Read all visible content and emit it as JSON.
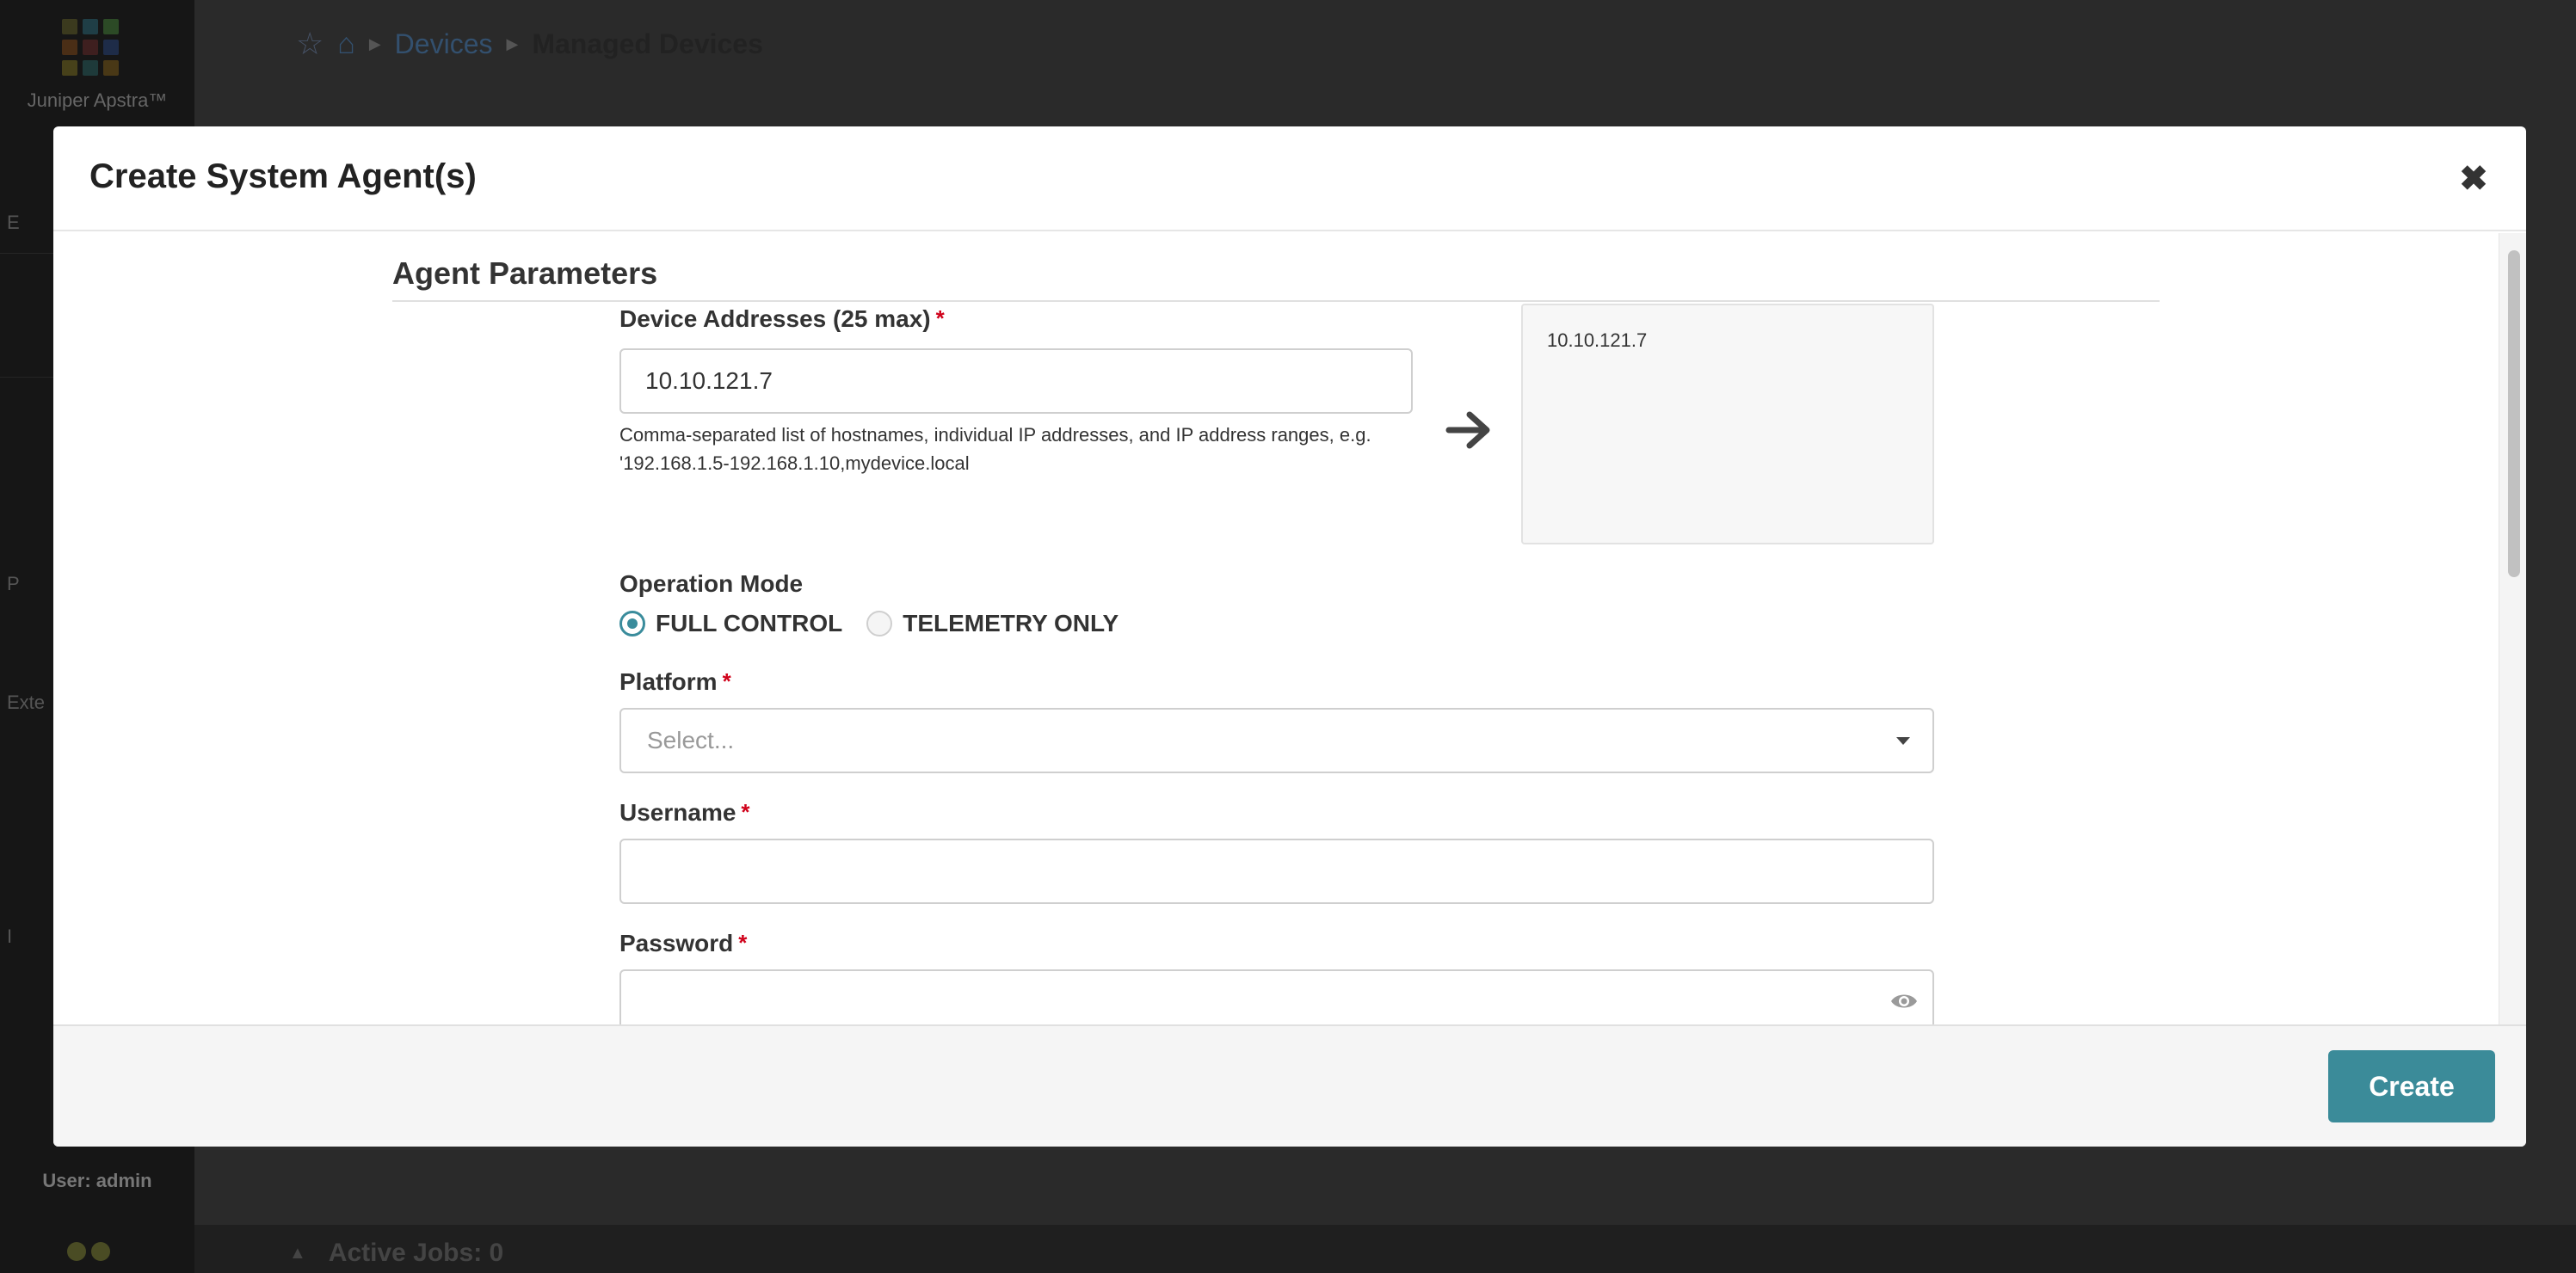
{
  "app": {
    "brand": "Juniper Apstra™",
    "user_label": "User: admin",
    "sidebar_fragments": [
      "E",
      "P",
      "Exte",
      "I"
    ]
  },
  "breadcrumb": {
    "items": [
      "Devices",
      "Managed Devices"
    ]
  },
  "footer_bar": {
    "active_jobs": "Active Jobs: 0"
  },
  "modal": {
    "title": "Create System Agent(s)",
    "section_title": "Agent Parameters",
    "device_addresses": {
      "label": "Device Addresses (25 max)",
      "required": "*",
      "value": "10.10.121.7",
      "helper": "Comma-separated list of hostnames, individual IP addresses, and IP address ranges, e.g. '192.168.1.5-192.168.1.10,mydevice.local"
    },
    "preview": {
      "items": [
        "10.10.121.7"
      ]
    },
    "operation_mode": {
      "label": "Operation Mode",
      "options": [
        "FULL CONTROL",
        "TELEMETRY ONLY"
      ],
      "selected": "FULL CONTROL"
    },
    "platform": {
      "label": "Platform",
      "required": "*",
      "placeholder": "Select..."
    },
    "username": {
      "label": "Username",
      "required": "*",
      "value": ""
    },
    "password": {
      "label": "Password",
      "required": "*",
      "value": ""
    },
    "create_label": "Create"
  },
  "colors": {
    "accent": "#3b8b99",
    "required": "#d0021b",
    "link": "#33506e"
  }
}
